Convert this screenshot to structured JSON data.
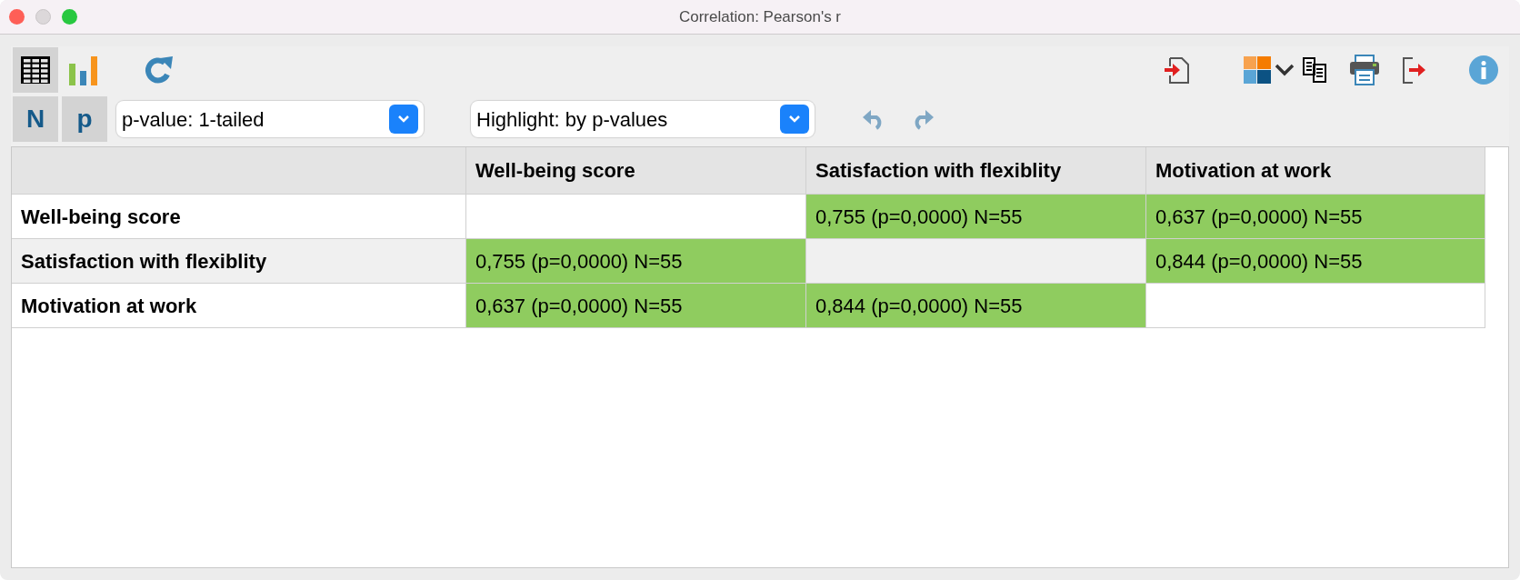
{
  "window": {
    "title": "Correlation: Pearson's r"
  },
  "view_buttons": [
    {
      "kind": "table",
      "selected": true
    },
    {
      "kind": "chart",
      "selected": false
    }
  ],
  "toggles": [
    {
      "label": "N",
      "on": true
    },
    {
      "label": "p",
      "on": true
    }
  ],
  "dropdowns": [
    {
      "value": "p-value: 1-tailed"
    },
    {
      "value": "Highlight: by p-values"
    }
  ],
  "table": {
    "columns": [
      "Well-being score",
      "Satisfaction with flexiblity",
      "Motivation at work"
    ],
    "rows": [
      {
        "label": "Well-being score",
        "cells": [
          {
            "highlighted": false
          },
          {
            "text": "0,755 (p=0,0000) N=55",
            "highlighted": true
          },
          {
            "text": "0,637 (p=0,0000) N=55",
            "highlighted": true
          }
        ]
      },
      {
        "label": "Satisfaction with flexiblity",
        "cells": [
          {
            "text": "0,755 (p=0,0000) N=55",
            "highlighted": true
          },
          {
            "highlighted": false
          },
          {
            "text": "0,844 (p=0,0000) N=55",
            "highlighted": true
          }
        ]
      },
      {
        "label": "Motivation at work",
        "cells": [
          {
            "text": "0,637 (p=0,0000) N=55",
            "highlighted": true
          },
          {
            "text": "0,844 (p=0,0000) N=55",
            "highlighted": true
          },
          {
            "highlighted": false
          }
        ]
      }
    ]
  }
}
